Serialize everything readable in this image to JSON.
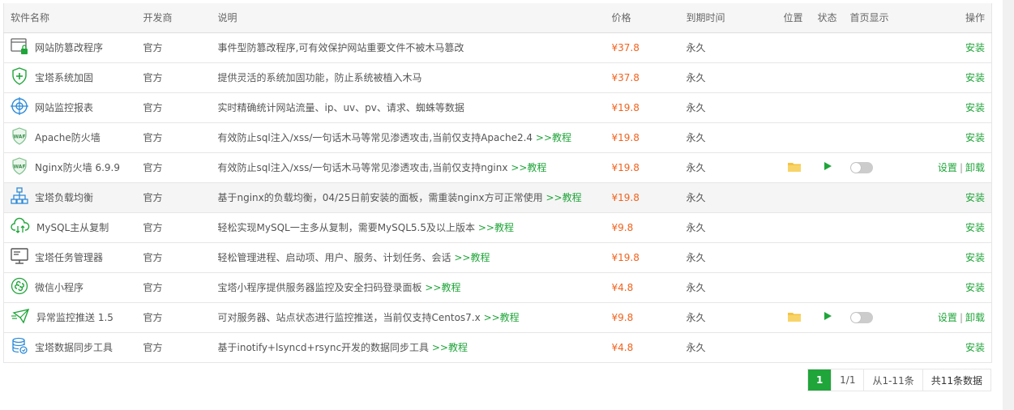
{
  "columns": {
    "name": "软件名称",
    "vendor": "开发商",
    "desc": "说明",
    "price": "价格",
    "expire": "到期时间",
    "location": "位置",
    "status": "状态",
    "homepage": "首页显示",
    "action": "操作"
  },
  "rows": [
    {
      "name": "网站防篡改程序",
      "icon": "webpage-lock-icon",
      "vendor": "官方",
      "desc": "事件型防篡改程序,可有效保护网站重要文件不被木马篡改",
      "tutorial": "",
      "price": "¥37.8",
      "expire": "永久",
      "installed": false,
      "install": "安装"
    },
    {
      "name": "宝塔系统加固",
      "icon": "shield-plus-icon",
      "vendor": "官方",
      "desc": "提供灵活的系统加固功能，防止系统被植入木马",
      "tutorial": "",
      "price": "¥37.8",
      "expire": "永久",
      "installed": false,
      "install": "安装"
    },
    {
      "name": "网站监控报表",
      "icon": "target-globe-icon",
      "vendor": "官方",
      "desc": "实时精确统计网站流量、ip、uv、pv、请求、蜘蛛等数据",
      "tutorial": "",
      "price": "¥19.8",
      "expire": "永久",
      "installed": false,
      "install": "安装"
    },
    {
      "name": "Apache防火墙",
      "icon": "waf-shield-icon",
      "vendor": "官方",
      "desc": "有效防止sql注入/xss/一句话木马等常见渗透攻击,当前仅支持Apache2.4",
      "tutorial": ">>教程",
      "price": "¥19.8",
      "expire": "永久",
      "installed": false,
      "install": "安装"
    },
    {
      "name": "Nginx防火墙 6.9.9",
      "icon": "waf-shield-icon",
      "vendor": "官方",
      "desc": "有效防止sql注入/xss/一句话木马等常见渗透攻击,当前仅支持nginx",
      "tutorial": ">>教程",
      "price": "¥19.8",
      "expire": "永久",
      "installed": true,
      "settings": "设置",
      "uninstall": "卸载"
    },
    {
      "name": "宝塔负载均衡",
      "icon": "network-tree-icon",
      "vendor": "官方",
      "desc": "基于nginx的负载均衡，04/25日前安装的面板，需重装nginx方可正常使用",
      "tutorial": ">>教程",
      "price": "¥19.8",
      "expire": "永久",
      "installed": false,
      "install": "安装"
    },
    {
      "name": "MySQL主从复制",
      "icon": "cloud-sync-icon",
      "vendor": "官方",
      "desc": "轻松实现MySQL一主多从复制，需要MySQL5.5及以上版本",
      "tutorial": ">>教程",
      "price": "¥9.8",
      "expire": "永久",
      "installed": false,
      "install": "安装"
    },
    {
      "name": "宝塔任务管理器",
      "icon": "monitor-icon",
      "vendor": "官方",
      "desc": "轻松管理进程、启动项、用户、服务、计划任务、会话",
      "tutorial": ">>教程",
      "price": "¥19.8",
      "expire": "永久",
      "installed": false,
      "install": "安装"
    },
    {
      "name": "微信小程序",
      "icon": "miniprogram-icon",
      "vendor": "官方",
      "desc": "宝塔小程序提供服务器监控及安全扫码登录面板",
      "tutorial": ">>教程",
      "price": "¥4.8",
      "expire": "永久",
      "installed": false,
      "install": "安装"
    },
    {
      "name": "异常监控推送 1.5",
      "icon": "mail-send-icon",
      "vendor": "官方",
      "desc": "可对服务器、站点状态进行监控推送，当前仅支持Centos7.x",
      "tutorial": ">>教程",
      "price": "¥9.8",
      "expire": "永久",
      "installed": true,
      "settings": "设置",
      "uninstall": "卸载"
    },
    {
      "name": "宝塔数据同步工具",
      "icon": "database-sync-icon",
      "vendor": "官方",
      "desc": "基于inotify+lsyncd+rsync开发的数据同步工具",
      "tutorial": ">>教程",
      "price": "¥4.8",
      "expire": "永久",
      "installed": false,
      "install": "安装"
    }
  ],
  "pager": {
    "current": "1",
    "pages": "1/1",
    "range": "从1-11条",
    "total": "共11条数据"
  },
  "colors": {
    "accent": "#20a53a",
    "price": "#f0631e",
    "folder": "#f5c342"
  }
}
